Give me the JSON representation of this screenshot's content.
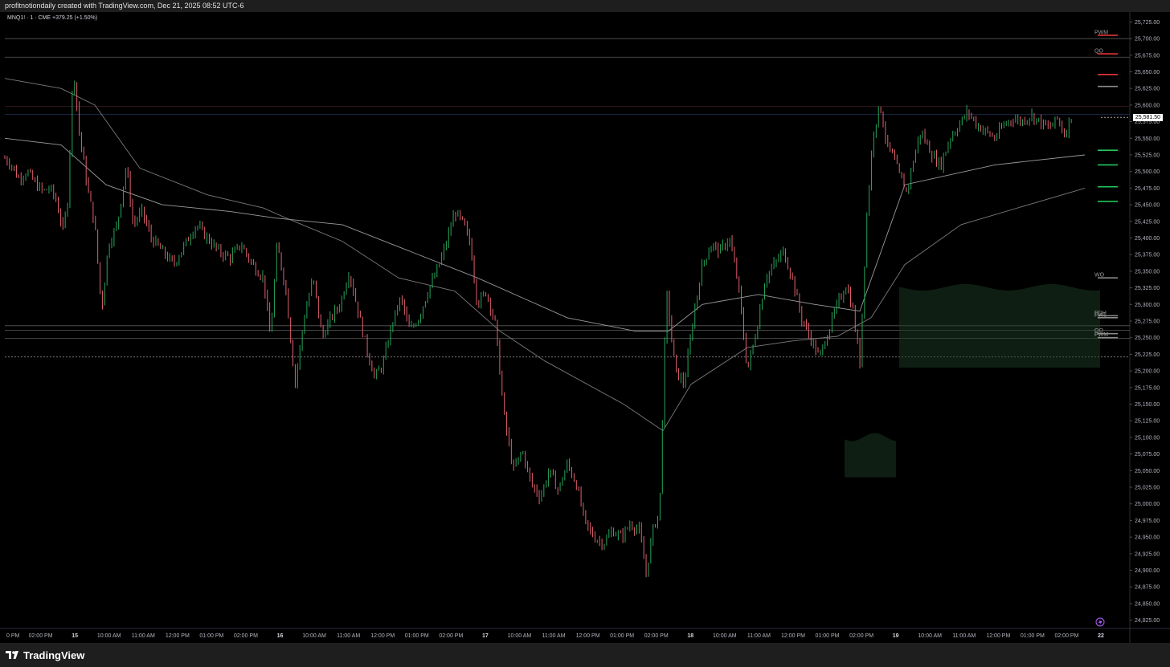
{
  "header": {
    "credit": "profitnotiondaily created with TradingView.com, Dec 21, 2025 08:52 UTC-6"
  },
  "legend": {
    "symbol": "MNQ1! · 1 · CME",
    "change": "+379.25 (+1.50%)"
  },
  "footer": {
    "brand": "TradingView"
  },
  "colors": {
    "background": "#000000",
    "up_candle": "#26a65b",
    "down_candle": "#e0606e",
    "current_price_tag": "#ffffff",
    "level_red": "#e3343a",
    "level_green": "#22c55e"
  },
  "chart_data": {
    "type": "candlestick",
    "symbol": "MNQ1!",
    "interval": "1",
    "exchange": "CME",
    "ylim": [
      24812.5,
      25737.5
    ],
    "y_ticks": [
      25725,
      25700,
      25675,
      25650,
      25625,
      25600,
      25575,
      25550,
      25525,
      25500,
      25475,
      25450,
      25425,
      25400,
      25375,
      25350,
      25325,
      25300,
      25275,
      25250,
      25225,
      25200,
      25175,
      25150,
      25125,
      25100,
      25075,
      25050,
      25025,
      25000,
      24975,
      24950,
      24925,
      24900,
      24875,
      24850,
      24825
    ],
    "y_tick_labels": [
      "25,725.00",
      "25,700.00",
      "25,675.00",
      "25,650.00",
      "25,625.00",
      "25,600.00",
      "25,575.00",
      "25,550.00",
      "25,525.00",
      "25,500.00",
      "25,475.00",
      "25,450.00",
      "25,425.00",
      "25,400.00",
      "25,375.00",
      "25,350.00",
      "25,325.00",
      "25,300.00",
      "25,275.00",
      "25,250.00",
      "25,225.00",
      "25,200.00",
      "25,175.00",
      "25,150.00",
      "25,125.00",
      "25,100.00",
      "25,075.00",
      "25,050.00",
      "25,025.00",
      "25,000.00",
      "24,975.00",
      "24,950.00",
      "24,925.00",
      "24,900.00",
      "24,875.00",
      "24,850.00",
      "24,825.00"
    ],
    "x_tick_labels": [
      "0 PM",
      "02:00 PM",
      "15",
      "10:00 AM",
      "11:00 AM",
      "12:00 PM",
      "01:00 PM",
      "02:00 PM",
      "16",
      "10:00 AM",
      "11:00 AM",
      "12:00 PM",
      "01:00 PM",
      "02:00 PM",
      "17",
      "10:00 AM",
      "11:00 AM",
      "12:00 PM",
      "01:00 PM",
      "02:00 PM",
      "18",
      "10:00 AM",
      "11:00 AM",
      "12:00 PM",
      "01:00 PM",
      "02:00 PM",
      "19",
      "10:00 AM",
      "11:00 AM",
      "12:00 PM",
      "01:00 PM",
      "02:00 PM",
      "22"
    ],
    "x_tick_bold": [
      false,
      false,
      true,
      false,
      false,
      false,
      false,
      false,
      true,
      false,
      false,
      false,
      false,
      false,
      true,
      false,
      false,
      false,
      false,
      false,
      true,
      false,
      false,
      false,
      false,
      false,
      true,
      false,
      false,
      false,
      false,
      false,
      true
    ],
    "current_price": 25581.5,
    "current_price_label": "25,581.50",
    "price_path": [
      [
        0,
        25520
      ],
      [
        0.6,
        25510
      ],
      [
        1.2,
        25490
      ],
      [
        2,
        25500
      ],
      [
        2.8,
        25480
      ],
      [
        3.4,
        25470
      ],
      [
        4,
        25475
      ],
      [
        4.5,
        25460
      ],
      [
        5.2,
        25410
      ],
      [
        5.6,
        25460
      ],
      [
        6.1,
        25660
      ],
      [
        6.6,
        25560
      ],
      [
        7.4,
        25470
      ],
      [
        8,
        25420
      ],
      [
        8.6,
        25290
      ],
      [
        9.2,
        25390
      ],
      [
        10,
        25420
      ],
      [
        10.8,
        25510
      ],
      [
        11.4,
        25420
      ],
      [
        12.2,
        25440
      ],
      [
        13,
        25400
      ],
      [
        14,
        25380
      ],
      [
        15,
        25360
      ],
      [
        16,
        25390
      ],
      [
        17,
        25420
      ],
      [
        18,
        25400
      ],
      [
        19,
        25380
      ],
      [
        20,
        25370
      ],
      [
        21,
        25390
      ],
      [
        22,
        25360
      ],
      [
        23,
        25340
      ],
      [
        23.6,
        25250
      ],
      [
        24.2,
        25390
      ],
      [
        25,
        25320
      ],
      [
        25.8,
        25180
      ],
      [
        26.6,
        25280
      ],
      [
        27.4,
        25340
      ],
      [
        28.2,
        25250
      ],
      [
        29,
        25280
      ],
      [
        29.8,
        25300
      ],
      [
        30.6,
        25350
      ],
      [
        31.4,
        25290
      ],
      [
        32.2,
        25230
      ],
      [
        32.9,
        25190
      ],
      [
        33.6,
        25210
      ],
      [
        34.4,
        25270
      ],
      [
        35.2,
        25310
      ],
      [
        36,
        25260
      ],
      [
        36.8,
        25280
      ],
      [
        37.6,
        25320
      ],
      [
        38.4,
        25350
      ],
      [
        39.2,
        25390
      ],
      [
        40,
        25440
      ],
      [
        40.8,
        25420
      ],
      [
        41.4,
        25390
      ],
      [
        42,
        25300
      ],
      [
        42.8,
        25320
      ],
      [
        43.6,
        25270
      ],
      [
        44.4,
        25130
      ],
      [
        45.2,
        25050
      ],
      [
        46,
        25080
      ],
      [
        46.8,
        25030
      ],
      [
        47.6,
        25010
      ],
      [
        48.4,
        25050
      ],
      [
        49.2,
        25020
      ],
      [
        50,
        25060
      ],
      [
        50.8,
        25030
      ],
      [
        51.6,
        24970
      ],
      [
        52.4,
        24950
      ],
      [
        53.2,
        24940
      ],
      [
        54,
        24960
      ],
      [
        54.8,
        24950
      ],
      [
        55.6,
        24970
      ],
      [
        56.4,
        24960
      ],
      [
        57,
        24895
      ],
      [
        57.6,
        24960
      ],
      [
        58.2,
        24990
      ],
      [
        58.8,
        25320
      ],
      [
        59.6,
        25200
      ],
      [
        60.4,
        25180
      ],
      [
        61.2,
        25280
      ],
      [
        62,
        25360
      ],
      [
        62.8,
        25390
      ],
      [
        63.6,
        25380
      ],
      [
        64.4,
        25400
      ],
      [
        65.2,
        25330
      ],
      [
        66,
        25200
      ],
      [
        66.8,
        25260
      ],
      [
        67.6,
        25340
      ],
      [
        68.4,
        25360
      ],
      [
        69.2,
        25380
      ],
      [
        70,
        25340
      ],
      [
        70.8,
        25280
      ],
      [
        71.6,
        25250
      ],
      [
        72.4,
        25220
      ],
      [
        73.2,
        25260
      ],
      [
        74,
        25300
      ],
      [
        74.8,
        25330
      ],
      [
        75.4,
        25290
      ],
      [
        76,
        25210
      ],
      [
        76.6,
        25430
      ],
      [
        77.2,
        25560
      ],
      [
        77.8,
        25600
      ],
      [
        78.4,
        25540
      ],
      [
        79,
        25520
      ],
      [
        79.6,
        25490
      ],
      [
        80.2,
        25470
      ],
      [
        80.8,
        25520
      ],
      [
        81.4,
        25560
      ],
      [
        82,
        25540
      ],
      [
        82.6,
        25520
      ],
      [
        83.2,
        25510
      ],
      [
        84,
        25550
      ],
      [
        84.8,
        25570
      ],
      [
        85.6,
        25590
      ],
      [
        86.4,
        25570
      ],
      [
        87.2,
        25560
      ],
      [
        88,
        25550
      ],
      [
        88.8,
        25570
      ],
      [
        89.6,
        25580
      ],
      [
        90.4,
        25575
      ],
      [
        91.2,
        25585
      ],
      [
        92,
        25575
      ],
      [
        92.8,
        25565
      ],
      [
        93.6,
        25580
      ],
      [
        94.2,
        25555
      ],
      [
        94.8,
        25585
      ]
    ],
    "horizontal_levels": [
      {
        "label": "PWM",
        "value": 25705,
        "color": "#e3343a"
      },
      {
        "label": "QO",
        "value": 25677,
        "color": "#e3343a"
      },
      {
        "label": "",
        "value": 25646,
        "color": "#e3343a"
      },
      {
        "label": "",
        "value": 25628,
        "color": "#8a8a8a"
      },
      {
        "label": "",
        "value": 25532,
        "color": "#22c55e"
      },
      {
        "label": "",
        "value": 25510,
        "color": "#22c55e"
      },
      {
        "label": "",
        "value": 25477,
        "color": "#22c55e"
      },
      {
        "label": "",
        "value": 25455,
        "color": "#22c55e"
      },
      {
        "label": "WO",
        "value": 25340,
        "color": "#8a8a8a"
      },
      {
        "label": "PDH",
        "value": 25283,
        "color": "#8a8a8a"
      },
      {
        "label": "PWL",
        "value": 25280,
        "color": "#8a8a8a"
      },
      {
        "label": "QO",
        "value": 25256,
        "color": "#8a8a8a"
      },
      {
        "label": "PWM",
        "value": 25250,
        "color": "#8a8a8a"
      }
    ]
  }
}
